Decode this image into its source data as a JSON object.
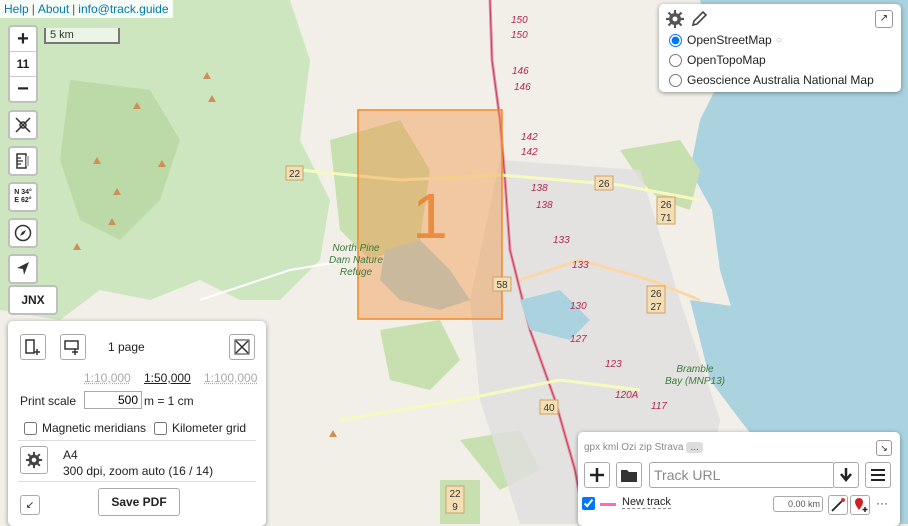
{
  "links": {
    "help": "Help",
    "about": "About",
    "email": "info@track.guide"
  },
  "scalebar": {
    "label": "5 km"
  },
  "zoom": {
    "in": "+",
    "level": "11",
    "out": "−"
  },
  "controls": {
    "coords_line1": "N 34°",
    "coords_line2": "E 62°",
    "jnx": "JNX"
  },
  "map": {
    "print_page_number": "1",
    "labels": {
      "dam": [
        "North Pine",
        "Dam Nature",
        "Refuge"
      ],
      "bay": [
        "Bramble",
        "Bay (MNP13)"
      ]
    },
    "road_numbers": [
      "150",
      "150",
      "146",
      "146",
      "142",
      "142",
      "138",
      "138",
      "133",
      "133",
      "130",
      "127",
      "123",
      "120A",
      "117"
    ],
    "shields": [
      "22",
      "26",
      "26",
      "71",
      "58",
      "26",
      "27",
      "40",
      "22",
      "9"
    ]
  },
  "layers": {
    "options": [
      {
        "label": "OpenStreetMap",
        "checked": true
      },
      {
        "label": "OpenTopoMap",
        "checked": false
      },
      {
        "label": "Geoscience Australia National Map",
        "checked": false
      }
    ]
  },
  "print": {
    "page_count": "1 page",
    "scales": [
      "1:10,000",
      "1:50,000",
      "1:100,000"
    ],
    "selected_scale": "1:50,000",
    "print_scale_label": "Print scale",
    "print_scale_value": "500",
    "print_scale_unit": "m = 1 cm",
    "magnetic_meridians": "Magnetic meridians",
    "kilometer_grid": "Kilometer grid",
    "paper": "A4",
    "resolution": "300 dpi, zoom auto (16  / 14)",
    "save_pdf": "Save PDF"
  },
  "tracks": {
    "formats": "gpx kml Ozi zip Strava",
    "more": "...",
    "url_placeholder": "Track URL",
    "track_name": "New track",
    "track_length": "0.00 km",
    "track_color": "#ff66cc",
    "menu_dots": "···"
  },
  "colors": {
    "accent": "#0078a8",
    "print_area": "#f29a4b",
    "park": "#c8dfb0",
    "water": "#aad3df"
  }
}
